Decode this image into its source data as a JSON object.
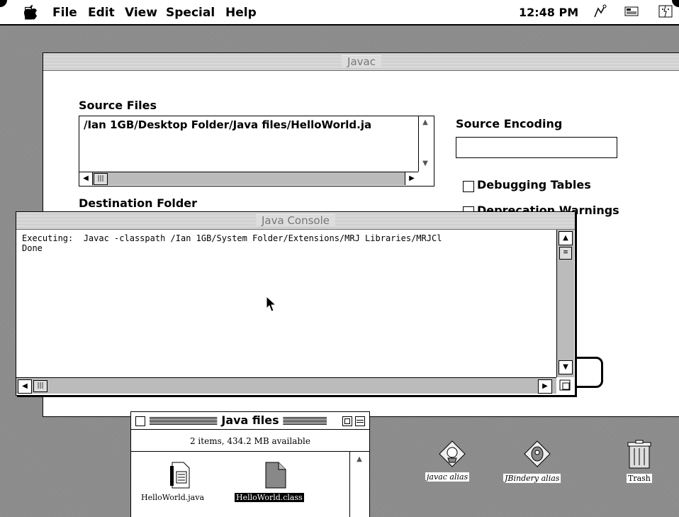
{
  "menubar": {
    "apple": "",
    "items": [
      "File",
      "Edit",
      "View",
      "Special",
      "Help"
    ],
    "clock": "12:48 PM"
  },
  "javac": {
    "title": "Javac",
    "source_files_label": "Source Files",
    "source_file_path": "/Ian 1GB/Desktop Folder/Java files/HelloWorld.ja",
    "source_encoding_label": "Source Encoding",
    "source_encoding_value": "",
    "debugging_tables_label": "Debugging Tables",
    "deprecation_warnings_label": "Deprecation Warnings",
    "destination_folder_label": "Destination Folder"
  },
  "console": {
    "title": "Java Console",
    "lines": [
      "Executing:  Javac -classpath /Ian 1GB/System Folder/Extensions/MRJ Libraries/MRJCl",
      "Done"
    ]
  },
  "java_files": {
    "title": "Java files",
    "info": "2 items, 434.2 MB available",
    "items": [
      "HelloWorld.java",
      "HelloWorld.class"
    ]
  },
  "desktop": {
    "icons": [
      "javac alias",
      "JBindery alias",
      "Trash"
    ]
  }
}
